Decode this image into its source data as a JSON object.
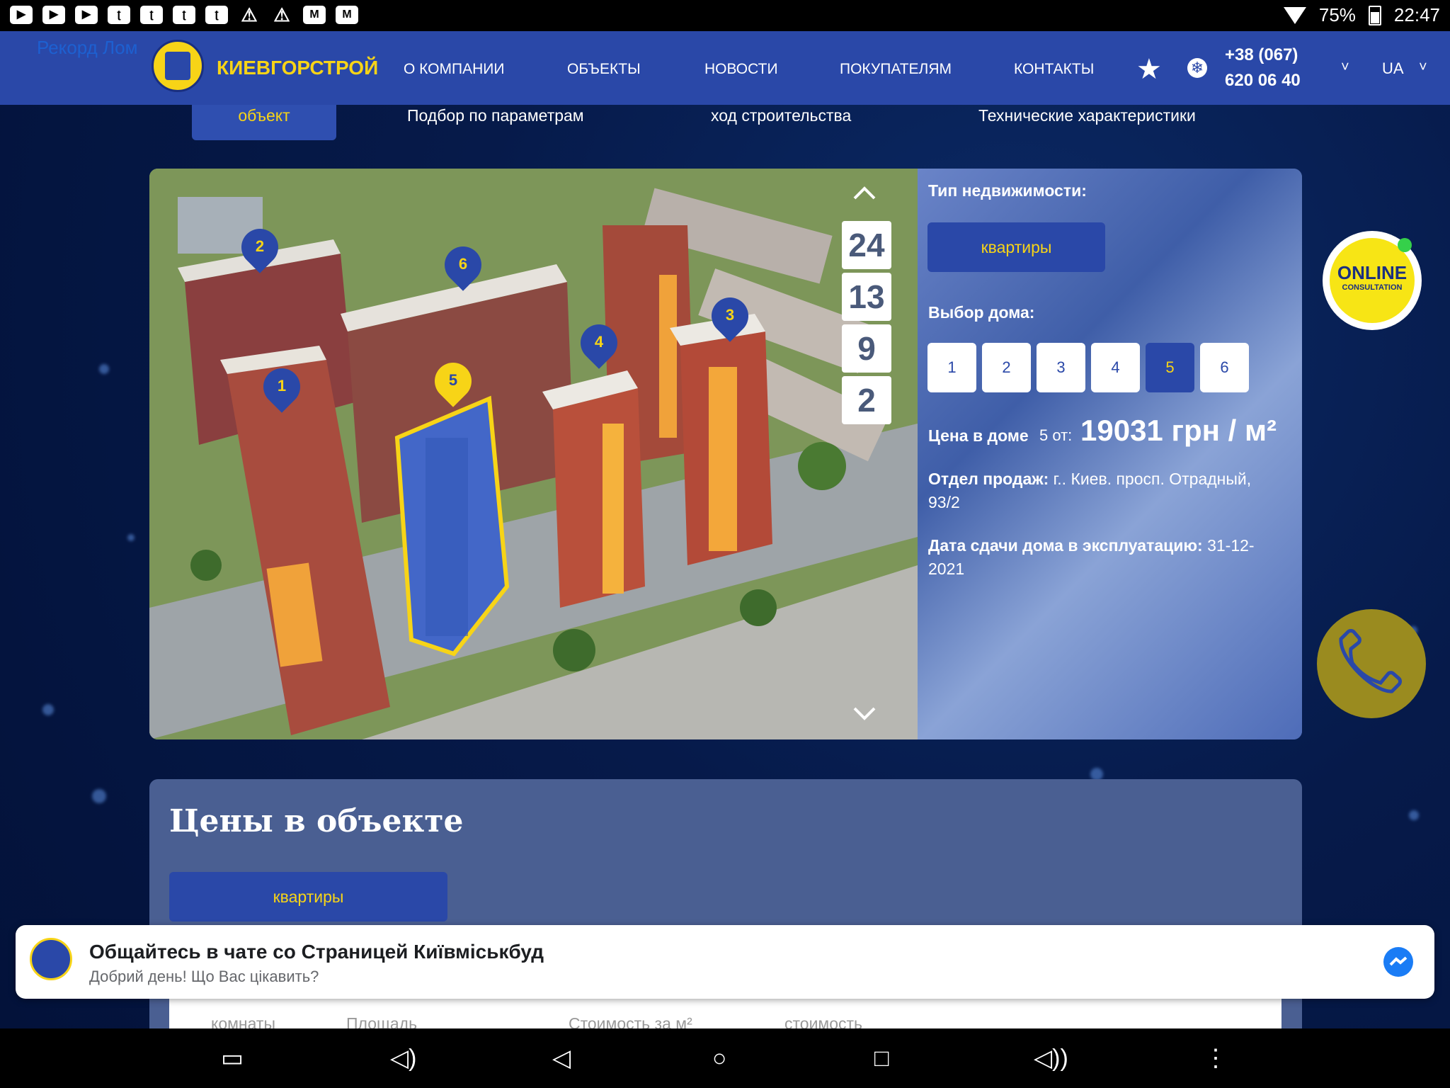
{
  "status_bar": {
    "app_icons": [
      "youtube-icon",
      "youtube-icon",
      "youtube-icon",
      "twitch-icon",
      "twitch-icon",
      "twitch-icon",
      "twitch-icon",
      "warning-icon",
      "warning-icon",
      "gmail-icon",
      "gmail-icon"
    ],
    "battery": "75%",
    "time": "22:47"
  },
  "header": {
    "ghost_text": "Рекорд Лом",
    "brand": "КИЕВГОРСТРОЙ",
    "nav": [
      "О КОМПАНИИ",
      "ОБЪЕКТЫ",
      "НОВОСТИ",
      "ПОКУПАТЕЛЯМ",
      "КОНТАКТЫ"
    ],
    "phone_line1": "+38 (067)",
    "phone_line2": "620 06 40",
    "lang": "UA"
  },
  "tabs": [
    "объект",
    "Подбор по параметрам",
    "ход строительства",
    "Технические характеристики"
  ],
  "scene": {
    "house_pins": [
      "1",
      "2",
      "3",
      "4",
      "5",
      "6"
    ],
    "floors": [
      "24",
      "13",
      "9",
      "2"
    ]
  },
  "info": {
    "type_label": "Тип недвижимости:",
    "type_button": "квартиры",
    "house_label": "Выбор дома:",
    "houses": [
      "1",
      "2",
      "3",
      "4",
      "5",
      "6"
    ],
    "selected_house": "5",
    "price_label": "Цена в доме",
    "price_house": "5 от:",
    "price_value": "19031 грн / м²",
    "sales_label": "Отдел продаж:",
    "sales_value": " г.. Киев. просп. Отрадный, 93/2",
    "date_label": "Дата сдачи дома в эксплуатацию:",
    "date_value": " 31-12-2021"
  },
  "prices": {
    "title": "Цены в объекте",
    "button": "квартиры",
    "columns": [
      "комнаты",
      "Площадь",
      "Стоимость за м²",
      "стоимость"
    ]
  },
  "online": {
    "line1": "ONLINE",
    "line2": "CONSULTATION"
  },
  "chat": {
    "title": "Общайтесь в чате со Страницей Київміськбуд",
    "subtitle": "Добрий день! Що Вас цікавить?"
  },
  "colors": {
    "brand_blue": "#2a48a8",
    "accent_yellow": "#f7d417",
    "page_bg": "#061a4a"
  }
}
